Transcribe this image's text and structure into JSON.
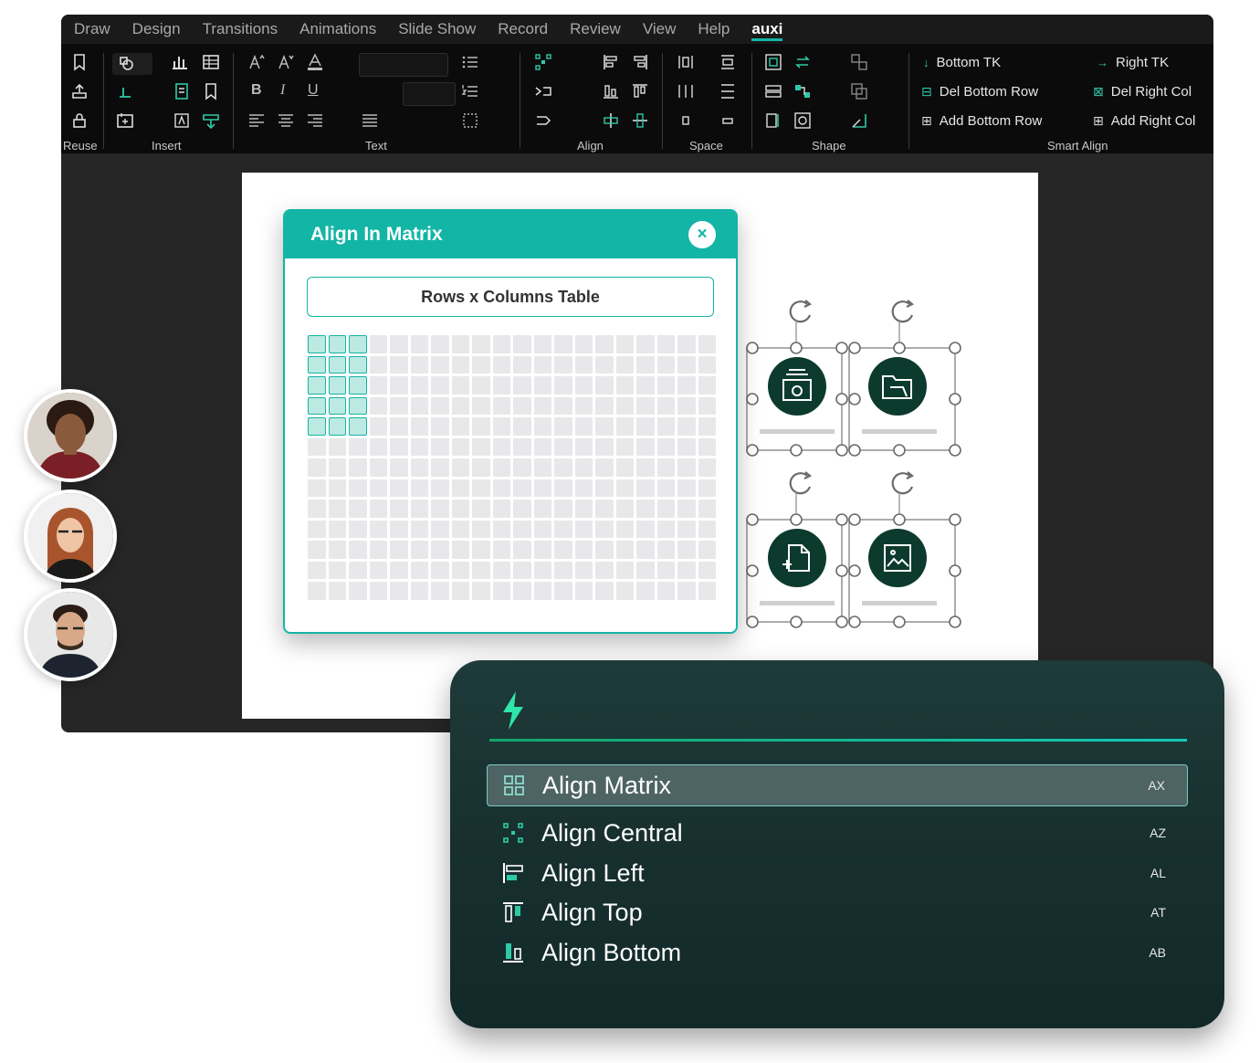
{
  "menubar": {
    "tabs": [
      "Draw",
      "Design",
      "Transitions",
      "Animations",
      "Slide Show",
      "Record",
      "Review",
      "View",
      "Help",
      "auxi"
    ],
    "active_tab": "auxi"
  },
  "ribbon": {
    "groups": {
      "reuse": "Reuse",
      "insert": "Insert",
      "text": "Text",
      "align": "Align",
      "space": "Space",
      "shape": "Shape",
      "smart_align": "Smart Align"
    },
    "smart_align": {
      "bottom_tk": "Bottom TK",
      "right_tk": "Right TK",
      "del_bottom_row": "Del Bottom Row",
      "del_right_col": "Del Right Col",
      "add_bottom_row": "Add Bottom Row",
      "add_right_col": "Add Right Col"
    },
    "text_format": {
      "bold": "B",
      "italic": "I",
      "underline": "U"
    }
  },
  "dialog": {
    "title": "Align In Matrix",
    "close": "×",
    "table_button": "Rows x Columns Table",
    "grid": {
      "columns": 20,
      "rows": 13,
      "selected_columns": 3,
      "selected_rows": 5
    }
  },
  "palette": {
    "items": [
      {
        "label": "Align Matrix",
        "shortcut": "AX",
        "icon": "grid-icon"
      },
      {
        "label": "Align Central",
        "shortcut": "AZ",
        "icon": "align-central-icon"
      },
      {
        "label": "Align Left",
        "shortcut": "AL",
        "icon": "align-left-icon"
      },
      {
        "label": "Align Top",
        "shortcut": "AT",
        "icon": "align-top-icon"
      },
      {
        "label": "Align Bottom",
        "shortcut": "AB",
        "icon": "align-bottom-icon"
      }
    ],
    "active_index": 0
  },
  "colors": {
    "accent": "#13b5a5",
    "icon_circle": "#0c3b2e",
    "palette_bg": "#1b3434",
    "bolt": "#2ee6a8"
  }
}
